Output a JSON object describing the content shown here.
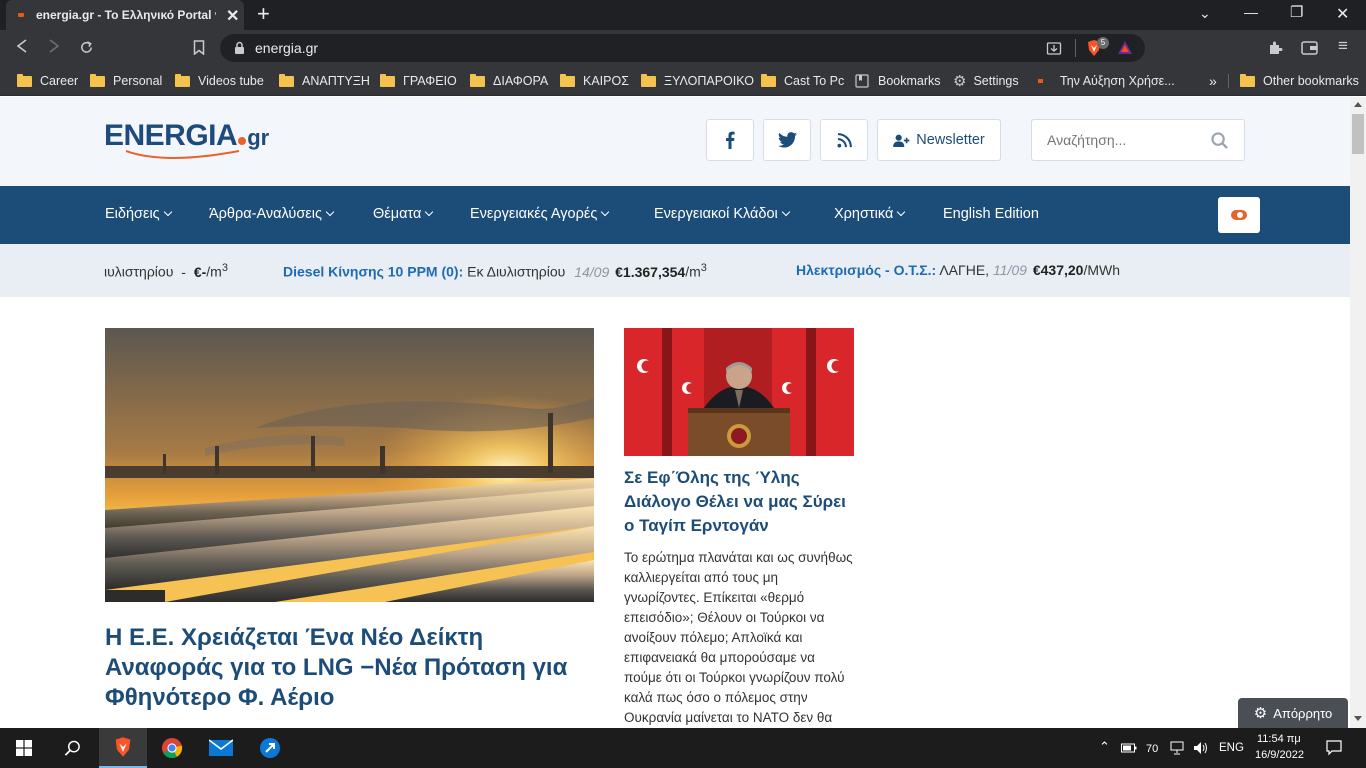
{
  "browser": {
    "tab_title": "energia.gr - Το Ελληνικό Portal για",
    "url": "energia.gr",
    "shield_count": "5"
  },
  "bookmarks": [
    {
      "label": "Career",
      "type": "folder"
    },
    {
      "label": "Personal",
      "type": "folder"
    },
    {
      "label": "Videos tube",
      "type": "folder"
    },
    {
      "label": "ΑΝΑΠΤΥΞΗ",
      "type": "folder"
    },
    {
      "label": "ΓΡΑΦΕΙΟ",
      "type": "folder"
    },
    {
      "label": "ΔΙΑΦΟΡΑ",
      "type": "folder"
    },
    {
      "label": "ΚΑΙΡΟΣ",
      "type": "folder"
    },
    {
      "label": "ΞΥΛΟΠΑΡΟΙΚΟ",
      "type": "folder"
    },
    {
      "label": "Cast To Pc",
      "type": "folder"
    },
    {
      "label": "Bookmarks",
      "type": "bookmarks-icon"
    },
    {
      "label": "Settings",
      "type": "gear-icon"
    },
    {
      "label": "Την Αύξηση Χρήσε...",
      "type": "page"
    }
  ],
  "other_bookmarks": "Other bookmarks",
  "site": {
    "logo_main": "ENERGIA",
    "logo_suffix": "gr",
    "newsletter_label": "Newsletter",
    "search_placeholder": "Αναζήτηση...",
    "menu": [
      {
        "label": "Ειδήσεις",
        "dropdown": true
      },
      {
        "label": "Άρθρα-Αναλύσεις",
        "dropdown": true
      },
      {
        "label": "Θέματα",
        "dropdown": true
      },
      {
        "label": "Ενεργειακές Αγορές",
        "dropdown": true
      },
      {
        "label": "Ενεργειακοί Κλάδοι",
        "dropdown": true
      },
      {
        "label": "Χρηστικά",
        "dropdown": true
      },
      {
        "label": "English Edition",
        "dropdown": false
      }
    ],
    "ticker": {
      "item1": {
        "source": "ιυλιστηρίου",
        "dash": "-",
        "price": "€-",
        "unit": "/m",
        "sup": "3"
      },
      "item2": {
        "name": "Diesel Κίνησης 10 PPM (0):",
        "source": "Εκ Διυλιστηρίου",
        "date": "14/09",
        "price": "€1.367,354",
        "unit": "/m",
        "sup": "3"
      },
      "item3": {
        "name": "Ηλεκτρισμός - Ο.Τ.Σ.:",
        "source": "ΛΑΓΗΕ,",
        "date": "11/09",
        "price": "€437,20",
        "unit": "/MWh"
      }
    },
    "hero": {
      "title": "Η Ε.Ε. Χρειάζεται Ένα Νέο Δείκτη Αναφοράς για το LNG −Νέα Πρόταση για Φθηνότερο Φ. Αέριο"
    },
    "side_article": {
      "title": "Σε Εφ΄Όλης της Ύλης Διάλογο Θέλει να μας Σύρει ο Ταγίπ Ερντογάν",
      "excerpt": "Το ερώτημα πλανάται και ως συνήθως καλλιεργείται από τους μη γνωρίζοντες. Επίκειται «θερμό επεισόδιο»; Θέλουν οι Τούρκοι να ανοίξουν πόλεμο; Απλοϊκά και επιφανειακά θα μπορούσαμε να πούμε ότι οι Τούρκοι γνωρίζουν πολύ καλά πως όσο ο πόλεμος στην Ουκρανία μαίνεται το ΝΑΤΟ δεν θα"
    },
    "privacy_label": "Απόρρητο"
  },
  "taskbar": {
    "battery": "70",
    "lang": "ENG",
    "time": "11:54 πμ",
    "date": "16/9/2022"
  },
  "colors": {
    "brand_blue": "#1c4c78",
    "accent_orange": "#e8632c",
    "ticker_blue": "#1e6ab4"
  }
}
